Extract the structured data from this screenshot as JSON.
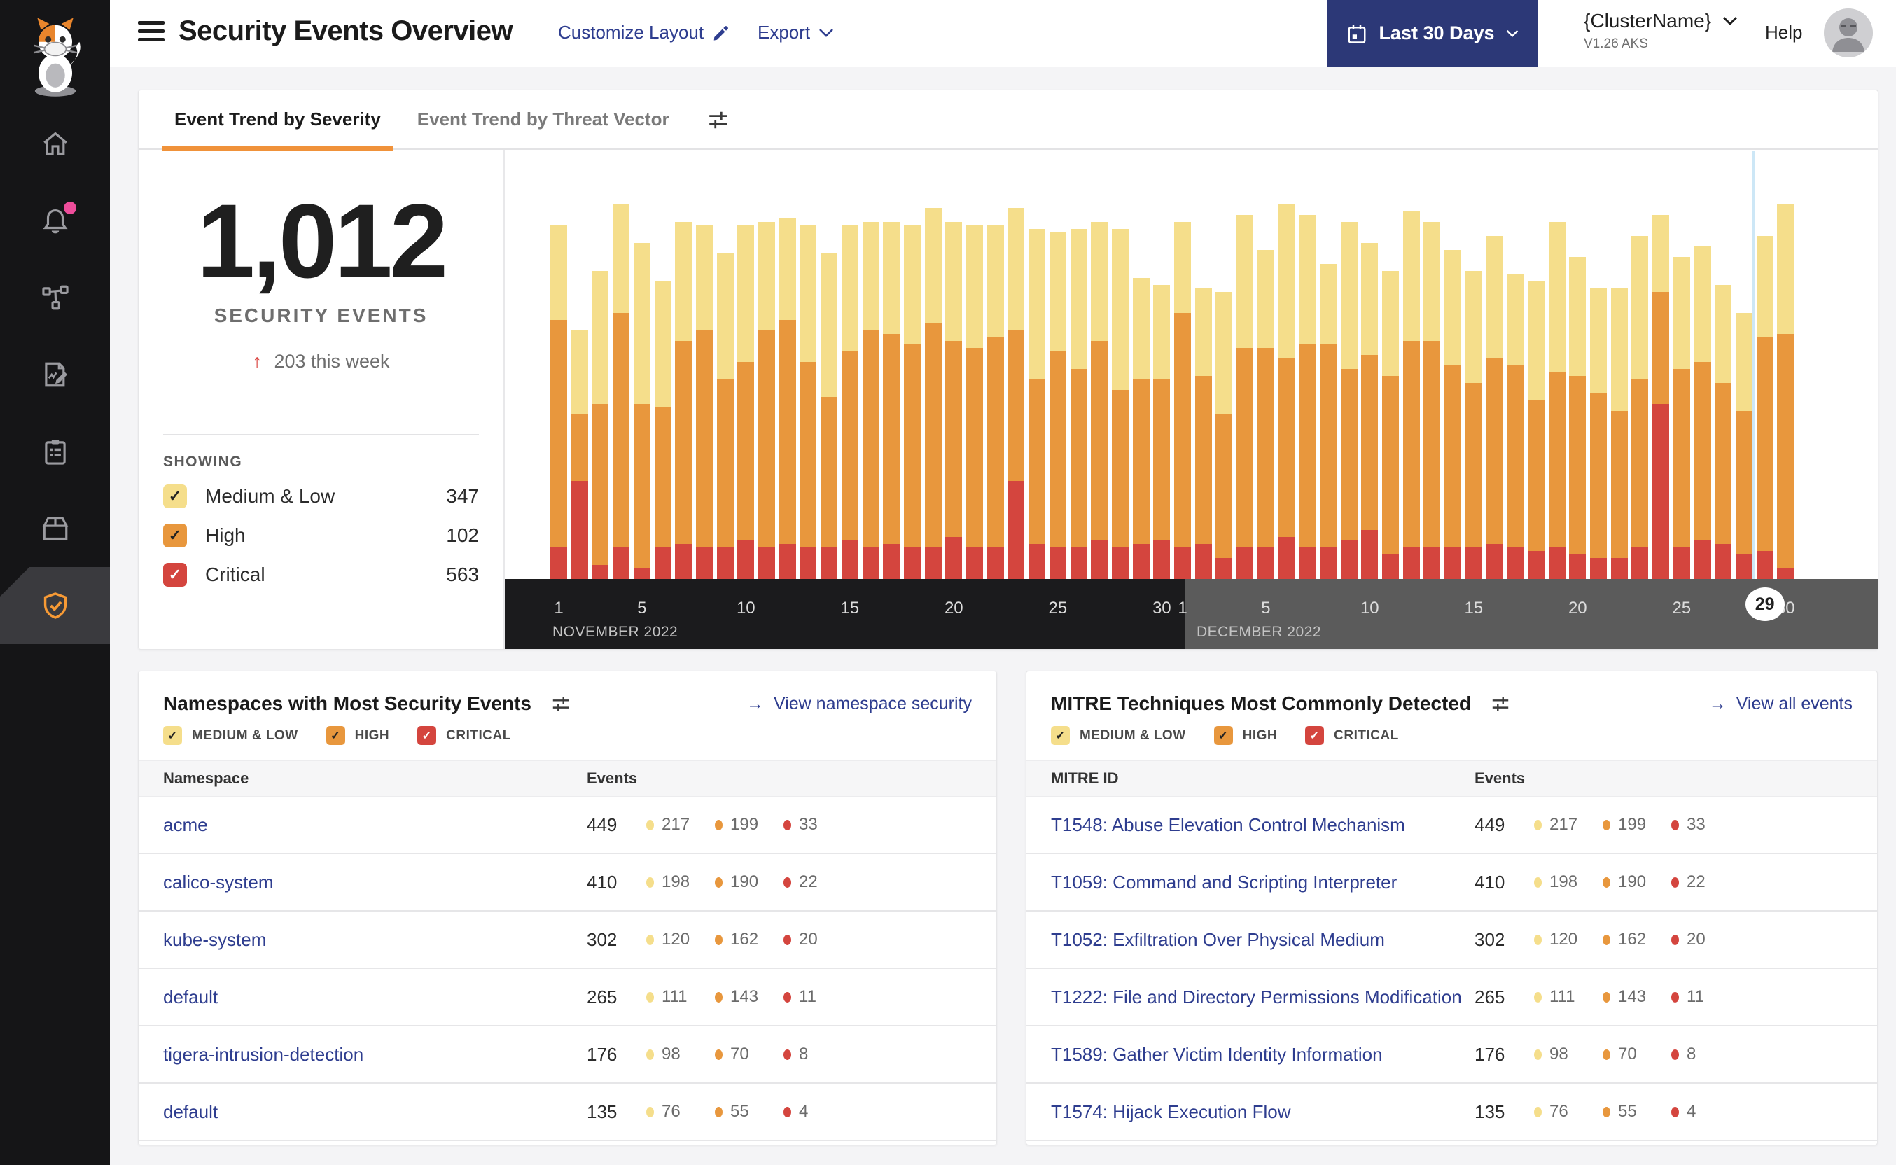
{
  "header": {
    "title": "Security Events Overview",
    "customize_layout": "Customize Layout",
    "export": "Export",
    "date_range": "Last 30 Days",
    "cluster_name": "{ClusterName}",
    "cluster_version": "V1.26 AKS",
    "help": "Help"
  },
  "tabs": {
    "severity": "Event Trend by Severity",
    "threat_vector": "Event Trend by Threat Vector"
  },
  "summary": {
    "total": "1,012",
    "label": "SECURITY EVENTS",
    "delta": "203 this week",
    "showing_label": "SHOWING",
    "filters": [
      {
        "key": "medium_low",
        "label": "Medium & Low",
        "count": 347
      },
      {
        "key": "high",
        "label": "High",
        "count": 102
      },
      {
        "key": "critical",
        "label": "Critical",
        "count": 563
      }
    ]
  },
  "severity_colors": {
    "medium_low": "#F5DE8B",
    "high": "#E8973D",
    "critical": "#D4453E"
  },
  "chart_data": {
    "type": "bar",
    "stacked": true,
    "series_names": [
      "Critical",
      "High",
      "Medium & Low"
    ],
    "unit": "rendered bar-segment heights in px (chart shows no numeric y-axis)",
    "x_axis": {
      "months": [
        {
          "label": "NOVEMBER 2022",
          "days": 30,
          "band_color": "#1B1B1D"
        },
        {
          "label": "DECEMBER 2022",
          "days": 30,
          "band_color": "#5B5B5B"
        }
      ],
      "ticks": [
        1,
        5,
        10,
        15,
        20,
        25,
        30
      ],
      "highlighted_tick": {
        "month_index": 1,
        "day": 29
      }
    },
    "bars": [
      {
        "month": "Nov",
        "day": 1,
        "critical": 45,
        "high": 325,
        "medium_low": 135
      },
      {
        "month": "Nov",
        "day": 2,
        "critical": 140,
        "high": 95,
        "medium_low": 120
      },
      {
        "month": "Nov",
        "day": 3,
        "critical": 20,
        "high": 230,
        "medium_low": 190
      },
      {
        "month": "Nov",
        "day": 4,
        "critical": 45,
        "high": 335,
        "medium_low": 155
      },
      {
        "month": "Nov",
        "day": 5,
        "critical": 15,
        "high": 235,
        "medium_low": 230
      },
      {
        "month": "Nov",
        "day": 6,
        "critical": 45,
        "high": 200,
        "medium_low": 180
      },
      {
        "month": "Nov",
        "day": 7,
        "critical": 50,
        "high": 290,
        "medium_low": 170
      },
      {
        "month": "Nov",
        "day": 8,
        "critical": 45,
        "high": 310,
        "medium_low": 150
      },
      {
        "month": "Nov",
        "day": 9,
        "critical": 45,
        "high": 240,
        "medium_low": 180
      },
      {
        "month": "Nov",
        "day": 10,
        "critical": 55,
        "high": 255,
        "medium_low": 195
      },
      {
        "month": "Nov",
        "day": 11,
        "critical": 45,
        "high": 310,
        "medium_low": 155
      },
      {
        "month": "Nov",
        "day": 12,
        "critical": 50,
        "high": 320,
        "medium_low": 145
      },
      {
        "month": "Nov",
        "day": 13,
        "critical": 45,
        "high": 265,
        "medium_low": 195
      },
      {
        "month": "Nov",
        "day": 14,
        "critical": 45,
        "high": 215,
        "medium_low": 205
      },
      {
        "month": "Nov",
        "day": 15,
        "critical": 55,
        "high": 270,
        "medium_low": 180
      },
      {
        "month": "Nov",
        "day": 16,
        "critical": 45,
        "high": 310,
        "medium_low": 155
      },
      {
        "month": "Nov",
        "day": 17,
        "critical": 50,
        "high": 300,
        "medium_low": 160
      },
      {
        "month": "Nov",
        "day": 18,
        "critical": 45,
        "high": 290,
        "medium_low": 170
      },
      {
        "month": "Nov",
        "day": 19,
        "critical": 45,
        "high": 320,
        "medium_low": 165
      },
      {
        "month": "Nov",
        "day": 20,
        "critical": 60,
        "high": 280,
        "medium_low": 170
      },
      {
        "month": "Nov",
        "day": 21,
        "critical": 45,
        "high": 285,
        "medium_low": 175
      },
      {
        "month": "Nov",
        "day": 22,
        "critical": 45,
        "high": 300,
        "medium_low": 160
      },
      {
        "month": "Nov",
        "day": 23,
        "critical": 140,
        "high": 215,
        "medium_low": 175
      },
      {
        "month": "Nov",
        "day": 24,
        "critical": 50,
        "high": 235,
        "medium_low": 215
      },
      {
        "month": "Nov",
        "day": 25,
        "critical": 45,
        "high": 280,
        "medium_low": 170
      },
      {
        "month": "Nov",
        "day": 26,
        "critical": 45,
        "high": 255,
        "medium_low": 200
      },
      {
        "month": "Nov",
        "day": 27,
        "critical": 55,
        "high": 285,
        "medium_low": 170
      },
      {
        "month": "Nov",
        "day": 28,
        "critical": 45,
        "high": 225,
        "medium_low": 230
      },
      {
        "month": "Nov",
        "day": 29,
        "critical": 50,
        "high": 235,
        "medium_low": 145
      },
      {
        "month": "Nov",
        "day": 30,
        "critical": 55,
        "high": 230,
        "medium_low": 135
      },
      {
        "month": "Dec",
        "day": 1,
        "critical": 45,
        "high": 335,
        "medium_low": 130
      },
      {
        "month": "Dec",
        "day": 2,
        "critical": 50,
        "high": 240,
        "medium_low": 125
      },
      {
        "month": "Dec",
        "day": 3,
        "critical": 30,
        "high": 205,
        "medium_low": 175
      },
      {
        "month": "Dec",
        "day": 4,
        "critical": 45,
        "high": 285,
        "medium_low": 190
      },
      {
        "month": "Dec",
        "day": 5,
        "critical": 45,
        "high": 285,
        "medium_low": 140
      },
      {
        "month": "Dec",
        "day": 6,
        "critical": 60,
        "high": 255,
        "medium_low": 220
      },
      {
        "month": "Dec",
        "day": 7,
        "critical": 45,
        "high": 290,
        "medium_low": 185
      },
      {
        "month": "Dec",
        "day": 8,
        "critical": 45,
        "high": 290,
        "medium_low": 115
      },
      {
        "month": "Dec",
        "day": 9,
        "critical": 55,
        "high": 245,
        "medium_low": 210
      },
      {
        "month": "Dec",
        "day": 10,
        "critical": 70,
        "high": 250,
        "medium_low": 160
      },
      {
        "month": "Dec",
        "day": 11,
        "critical": 35,
        "high": 255,
        "medium_low": 150
      },
      {
        "month": "Dec",
        "day": 12,
        "critical": 45,
        "high": 295,
        "medium_low": 185
      },
      {
        "month": "Dec",
        "day": 13,
        "critical": 45,
        "high": 295,
        "medium_low": 170
      },
      {
        "month": "Dec",
        "day": 14,
        "critical": 45,
        "high": 260,
        "medium_low": 165
      },
      {
        "month": "Dec",
        "day": 15,
        "critical": 45,
        "high": 235,
        "medium_low": 160
      },
      {
        "month": "Dec",
        "day": 16,
        "critical": 50,
        "high": 265,
        "medium_low": 175
      },
      {
        "month": "Dec",
        "day": 17,
        "critical": 45,
        "high": 260,
        "medium_low": 130
      },
      {
        "month": "Dec",
        "day": 18,
        "critical": 40,
        "high": 215,
        "medium_low": 170
      },
      {
        "month": "Dec",
        "day": 19,
        "critical": 45,
        "high": 250,
        "medium_low": 215
      },
      {
        "month": "Dec",
        "day": 20,
        "critical": 35,
        "high": 255,
        "medium_low": 170
      },
      {
        "month": "Dec",
        "day": 21,
        "critical": 30,
        "high": 235,
        "medium_low": 150
      },
      {
        "month": "Dec",
        "day": 22,
        "critical": 30,
        "high": 210,
        "medium_low": 175
      },
      {
        "month": "Dec",
        "day": 23,
        "critical": 45,
        "high": 240,
        "medium_low": 205
      },
      {
        "month": "Dec",
        "day": 24,
        "critical": 250,
        "high": 160,
        "medium_low": 110
      },
      {
        "month": "Dec",
        "day": 25,
        "critical": 45,
        "high": 255,
        "medium_low": 160
      },
      {
        "month": "Dec",
        "day": 26,
        "critical": 55,
        "high": 255,
        "medium_low": 165
      },
      {
        "month": "Dec",
        "day": 27,
        "critical": 50,
        "high": 230,
        "medium_low": 140
      },
      {
        "month": "Dec",
        "day": 28,
        "critical": 35,
        "high": 205,
        "medium_low": 140
      },
      {
        "month": "Dec",
        "day": 29,
        "critical": 40,
        "high": 305,
        "medium_low": 145
      },
      {
        "month": "Dec",
        "day": 30,
        "critical": 15,
        "high": 335,
        "medium_low": 185
      }
    ]
  },
  "namespaces_card": {
    "title": "Namespaces with Most Security Events",
    "link": "View namespace security",
    "columns": {
      "name": "Namespace",
      "events": "Events"
    },
    "filters": [
      {
        "key": "medium_low",
        "label": "MEDIUM & LOW"
      },
      {
        "key": "high",
        "label": "HIGH"
      },
      {
        "key": "critical",
        "label": "CRITICAL"
      }
    ],
    "rows": [
      {
        "name": "acme",
        "total": 449,
        "medium_low": 217,
        "high": 199,
        "critical": 33
      },
      {
        "name": "calico-system",
        "total": 410,
        "medium_low": 198,
        "high": 190,
        "critical": 22
      },
      {
        "name": "kube-system",
        "total": 302,
        "medium_low": 120,
        "high": 162,
        "critical": 20
      },
      {
        "name": "default",
        "total": 265,
        "medium_low": 111,
        "high": 143,
        "critical": 11
      },
      {
        "name": "tigera-intrusion-detection",
        "total": 176,
        "medium_low": 98,
        "high": 70,
        "critical": 8
      },
      {
        "name": "default",
        "total": 135,
        "medium_low": 76,
        "high": 55,
        "critical": 4
      }
    ]
  },
  "mitre_card": {
    "title": "MITRE Techniques Most Commonly Detected",
    "link": "View all events",
    "columns": {
      "name": "MITRE ID",
      "events": "Events"
    },
    "filters": [
      {
        "key": "medium_low",
        "label": "MEDIUM & LOW"
      },
      {
        "key": "high",
        "label": "HIGH"
      },
      {
        "key": "critical",
        "label": "CRITICAL"
      }
    ],
    "rows": [
      {
        "name": "T1548: Abuse Elevation Control Mechanism",
        "total": 449,
        "medium_low": 217,
        "high": 199,
        "critical": 33
      },
      {
        "name": "T1059: Command and Scripting Interpreter",
        "total": 410,
        "medium_low": 198,
        "high": 190,
        "critical": 22
      },
      {
        "name": "T1052: Exfiltration Over Physical Medium",
        "total": 302,
        "medium_low": 120,
        "high": 162,
        "critical": 20
      },
      {
        "name": "T1222: File and Directory Permissions Modification",
        "total": 265,
        "medium_low": 111,
        "high": 143,
        "critical": 11
      },
      {
        "name": "T1589: Gather Victim Identity Information",
        "total": 176,
        "medium_low": 98,
        "high": 70,
        "critical": 8
      },
      {
        "name": "T1574: Hijack Execution Flow",
        "total": 135,
        "medium_low": 76,
        "high": 55,
        "critical": 4
      }
    ]
  }
}
